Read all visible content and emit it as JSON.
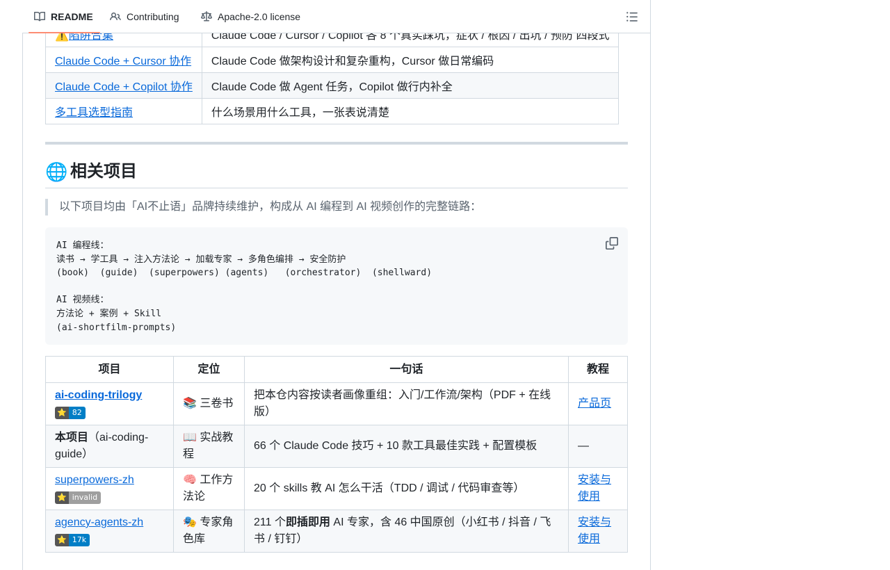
{
  "tabs": [
    {
      "label": "README",
      "icon": "book-icon"
    },
    {
      "label": "Contributing",
      "icon": "people-icon"
    },
    {
      "label": "Apache-2.0 license",
      "icon": "law-icon"
    }
  ],
  "top_table": {
    "rows": [
      {
        "prefix": "⚠️",
        "link": "陷阱合集",
        "desc": "Claude Code / Cursor / Copilot 各 8 个真实踩坑，症状 / 根因 / 出坑 / 预防 四段式"
      },
      {
        "link": "Claude Code + Cursor 协作",
        "desc": "Claude Code 做架构设计和复杂重构，Cursor 做日常编码"
      },
      {
        "link": "Claude Code + Copilot 协作",
        "desc": "Claude Code 做 Agent 任务，Copilot 做行内补全"
      },
      {
        "link": "多工具选型指南",
        "desc": "什么场景用什么工具，一张表说清楚"
      }
    ]
  },
  "section": {
    "emoji": "🌐",
    "title": "相关项目"
  },
  "quote": "以下项目均由「AI不止语」品牌持续维护，构成从 AI 编程到 AI 视频创作的完整链路：",
  "code_block": "AI 编程线：\n读书 → 学工具 → 注入方法论 → 加载专家 → 多角色编排 → 安全防护\n(book)  (guide)  (superpowers) (agents)   (orchestrator)  (shellward)\n\nAI 视频线：\n方法论 + 案例 + Skill\n(ai-shortfilm-prompts)",
  "projects": {
    "headers": [
      "项目",
      "定位",
      "一句话",
      "教程"
    ],
    "rows": [
      {
        "name": "ai-coding-trilogy",
        "link": true,
        "bold": true,
        "badge": {
          "star": "⭐",
          "value": "82",
          "color": "#007ec6"
        },
        "position": "📚 三卷书",
        "summary": "把本仓内容按读者画像重组：入门/工作流/架构（PDF + 在线版）",
        "tutorial": "产品页"
      },
      {
        "name": "本项目",
        "name_suffix": "（ai-coding-guide）",
        "link": false,
        "position": "📖 实战教程",
        "summary": "66 个 Claude Code 技巧 + 10 款工具最佳实践 + 配置模板",
        "tutorial": "—"
      },
      {
        "name": "superpowers-zh",
        "link": true,
        "badge": {
          "star": "⭐",
          "value": "invalid",
          "color": "#9f9f9f"
        },
        "position": "🧠 工作方法论",
        "summary": "20 个 skills 教 AI 怎么干活（TDD / 调试 / 代码审查等）",
        "tutorial": "安装与使用"
      },
      {
        "name": "agency-agents-zh",
        "link": true,
        "badge": {
          "star": "⭐",
          "value": "17k",
          "color": "#007ec6"
        },
        "position": "🎭 专家角色库",
        "summary_pre": "211 个",
        "summary_bold": "即插即用",
        "summary_post": " AI 专家，含 46 中国原创（小红书 / 抖音 / 飞书 / 钉钉）",
        "tutorial": "安装与使用"
      }
    ]
  }
}
